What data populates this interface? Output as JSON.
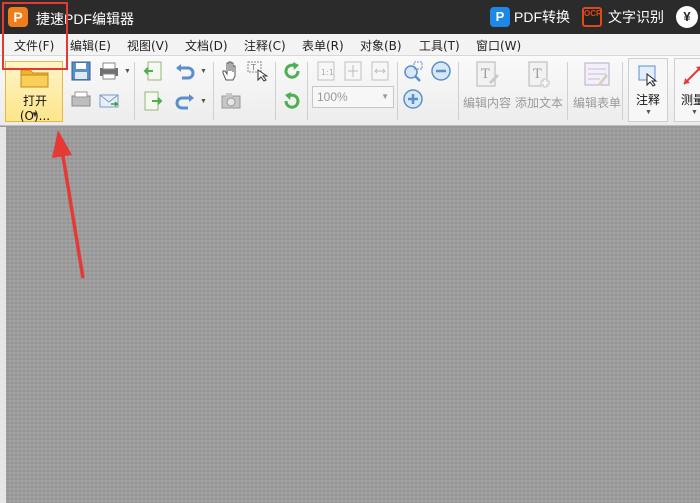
{
  "app": {
    "icon_letter": "P",
    "title": "捷速PDF编辑器"
  },
  "titlebar_right": {
    "pdf_icon": "P",
    "pdf_convert": "PDF转换",
    "ocr_icon": "OCR",
    "ocr_label": "文字识别",
    "currency": "¥"
  },
  "menu": [
    "文件(F)",
    "编辑(E)",
    "视图(V)",
    "文档(D)",
    "注释(C)",
    "表单(R)",
    "对象(B)",
    "工具(T)",
    "窗口(W)"
  ],
  "toolbar": {
    "open_label": "打开(O)...",
    "zoom_value": "100%",
    "edit_content": "编辑内容",
    "add_text": "添加文本",
    "edit_form": "编辑表单",
    "annotation": "注释",
    "measure": "测量"
  },
  "colors": {
    "accent": "#f07d1a",
    "highlight": "#e53935",
    "pdf_blue": "#1e88e5"
  }
}
